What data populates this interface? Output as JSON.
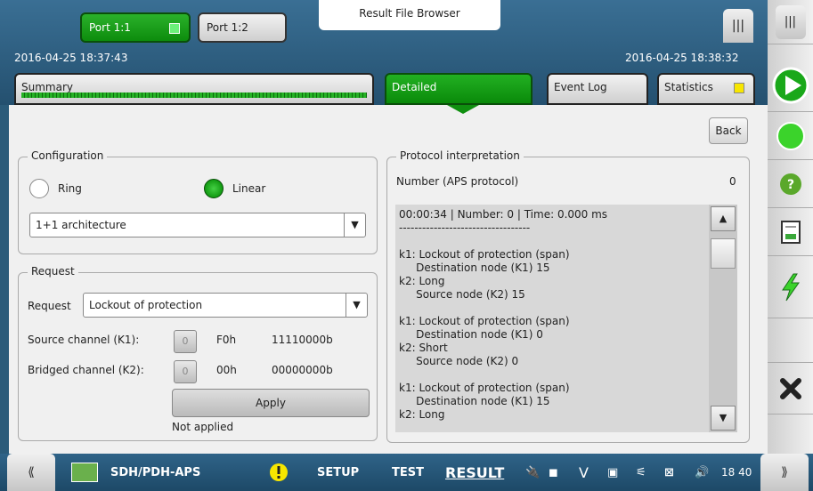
{
  "header": {
    "port1_label": "Port 1:1",
    "port2_label": "Port 1:2",
    "result_file_browser": "Result File Browser",
    "start_time": "2016-04-25 18:37:43",
    "end_time": "2016-04-25 18:38:32"
  },
  "tabs": {
    "summary": "Summary",
    "detailed": "Detailed",
    "event_log": "Event Log",
    "statistics": "Statistics"
  },
  "main": {
    "back_label": "Back",
    "configuration": {
      "legend": "Configuration",
      "ring_label": "Ring",
      "linear_label": "Linear",
      "selected_mode": "Linear",
      "architecture": "1+1 architecture"
    },
    "request": {
      "legend": "Request",
      "request_label": "Request",
      "request_value": "Lockout of protection",
      "source_label": "Source channel (K1):",
      "source_box": "0",
      "source_hex": "F0h",
      "source_bin": "11110000b",
      "bridged_label": "Bridged channel (K2):",
      "bridged_box": "0",
      "bridged_hex": "00h",
      "bridged_bin": "00000000b",
      "apply_label": "Apply",
      "status": "Not applied"
    },
    "protocol": {
      "legend": "Protocol interpretation",
      "number_label": "Number (APS protocol)",
      "number_value": "0",
      "log_text": "00:00:34 | Number: 0 | Time: 0.000 ms\n----------------------------------\n\nk1: Lockout of protection (span)\n     Destination node (K1) 15\nk2: Long\n     Source node (K2) 15\n\nk1: Lockout of protection (span)\n     Destination node (K1) 0\nk2: Short\n     Source node (K2) 0\n\nk1: Lockout of protection (span)\n     Destination node (K1) 15\nk2: Long"
    }
  },
  "bottom": {
    "test_name": "SDH/PDH-APS",
    "setup": "SETUP",
    "test": "TEST",
    "result": "RESULT",
    "v_label": "V",
    "clock": "18 40"
  },
  "colors": {
    "accent_green": "#129a12",
    "header_blue": "#2b5b7a",
    "indicator_yellow": "#f7e600"
  },
  "icons": [
    "play-icon",
    "green-circle-icon",
    "help-icon",
    "report-icon",
    "lightning-icon",
    "close-icon",
    "warning-icon",
    "plug-icon",
    "camera-icon",
    "wifi-icon",
    "volume-icon"
  ]
}
